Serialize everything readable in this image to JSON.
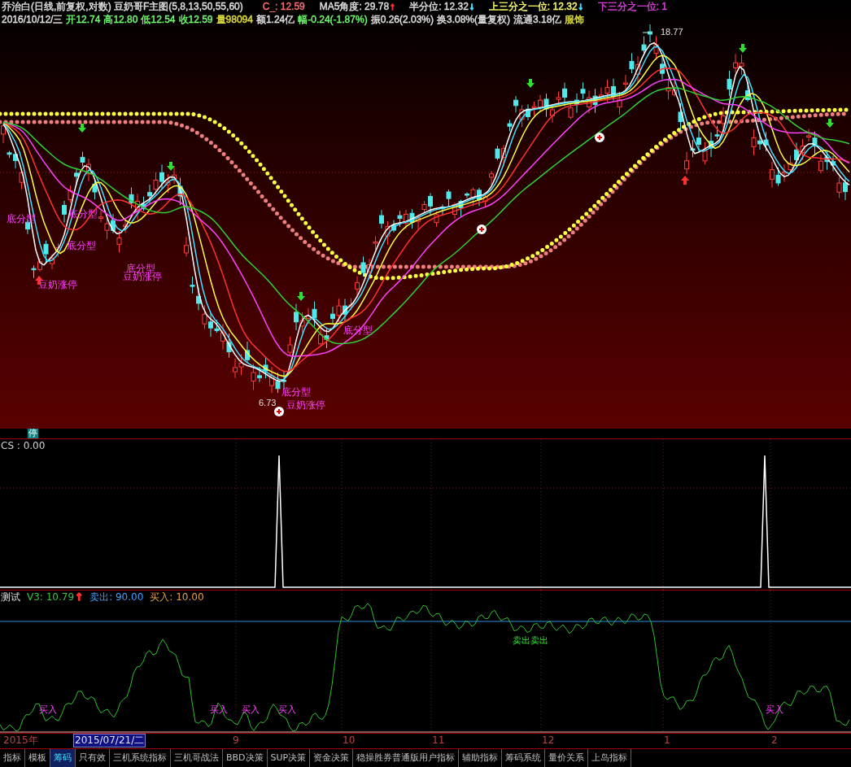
{
  "header": {
    "title": "乔治白(日线,前复权,对数) 豆奶哥F主图(5,8,13,50,55,60)",
    "indicators": [
      {
        "label": "C_: 12.59",
        "color": "#ff7070"
      },
      {
        "label": "MA5角度: 29.78",
        "color": "#e0e0e0",
        "arrow": {
          "text": "↑",
          "color": "#ff3030"
        }
      },
      {
        "label": "半分位: 12.32",
        "color": "#e0e0e0",
        "arrow": {
          "text": "↓",
          "color": "#40e0ff"
        }
      },
      {
        "label": "上三分之一位: 12.32",
        "color": "#ffff70",
        "arrow": {
          "text": "↓",
          "color": "#40e0ff"
        }
      },
      {
        "label": "下三分之一位: 1",
        "color": "#e040e0"
      }
    ],
    "quote": [
      {
        "text": "2016/10/12/三",
        "color": "#e0e0e0"
      },
      {
        "text": "开12.74",
        "color": "#70ff70"
      },
      {
        "text": "高12.80",
        "color": "#70ff70"
      },
      {
        "text": "低12.54",
        "color": "#70ff70"
      },
      {
        "text": "收12.59",
        "color": "#70ff70"
      },
      {
        "text": "量98094",
        "color": "#e0e040"
      },
      {
        "text": "额1.24亿",
        "color": "#e0e0e0"
      },
      {
        "text": "幅-0.24(-1.87%)",
        "color": "#70ff70"
      },
      {
        "text": "振0.26(2.03%)",
        "color": "#e0e0e0"
      },
      {
        "text": "换3.08%(量复权)",
        "color": "#e0e0e0"
      },
      {
        "text": "流通3.18亿",
        "color": "#e0e0e0"
      },
      {
        "text": "服饰",
        "color": "#e0e040"
      }
    ]
  },
  "chart_labels": [
    {
      "text": "底分型",
      "kind": "pattern"
    },
    {
      "text": "底分型",
      "kind": "pattern"
    },
    {
      "text": "底分型",
      "kind": "pattern"
    },
    {
      "text": "底分型",
      "kind": "pattern"
    },
    {
      "text": "豆奶涨停",
      "kind": "pattern"
    },
    {
      "text": "豆奶涨停",
      "kind": "pattern"
    },
    {
      "text": "底分型",
      "kind": "pattern"
    },
    {
      "text": "底分型",
      "kind": "pattern"
    },
    {
      "text": "豆奶涨停",
      "kind": "pattern"
    },
    {
      "text": "18.77",
      "kind": "price"
    },
    {
      "text": "6.73",
      "kind": "price"
    }
  ],
  "stop_badge": "停",
  "cs_panel": {
    "label": "CS : 0.00"
  },
  "test_panel": {
    "title": "测试",
    "readouts": [
      {
        "label": "V3: 10.79",
        "color": "#40c040",
        "arrow": {
          "text": "↑",
          "color": "#ff3030"
        }
      },
      {
        "label": "卖出: 90.00",
        "color": "#40a0ff"
      },
      {
        "label": "买入: 10.00",
        "color": "#e8a040"
      }
    ],
    "signals": [
      {
        "text": "卖出",
        "kind": "sell"
      },
      {
        "text": "卖出",
        "kind": "sell"
      },
      {
        "text": "买入",
        "kind": "buy"
      },
      {
        "text": "买入",
        "kind": "buy"
      },
      {
        "text": "买入",
        "kind": "buy"
      },
      {
        "text": "买入",
        "kind": "buy"
      },
      {
        "text": "买入",
        "kind": "buy"
      }
    ]
  },
  "time_axis": [
    {
      "label": "2015年",
      "selected": false
    },
    {
      "label": "2015/07/21/二",
      "selected": true
    },
    {
      "label": "9",
      "selected": false
    },
    {
      "label": "10",
      "selected": false
    },
    {
      "label": "11",
      "selected": false
    },
    {
      "label": "12",
      "selected": false
    },
    {
      "label": "1",
      "selected": false
    },
    {
      "label": "2",
      "selected": false
    }
  ],
  "tabs": [
    {
      "label": "指标",
      "selected": false
    },
    {
      "label": "模板",
      "selected": false
    },
    {
      "label": "筹码",
      "selected": true
    },
    {
      "label": "只有效",
      "selected": false
    },
    {
      "label": "三机系统指标",
      "selected": false
    },
    {
      "label": "三机哥战法",
      "selected": false
    },
    {
      "label": "BBD决策",
      "selected": false
    },
    {
      "label": "SUP决策",
      "selected": false
    },
    {
      "label": "资金决策",
      "selected": false
    },
    {
      "label": "稳操胜券普通版用户指标",
      "selected": false
    },
    {
      "label": "辅助指标",
      "selected": false
    },
    {
      "label": "筹码系统",
      "selected": false
    },
    {
      "label": "量价关系",
      "selected": false
    },
    {
      "label": "上岛指标",
      "selected": false
    }
  ]
}
